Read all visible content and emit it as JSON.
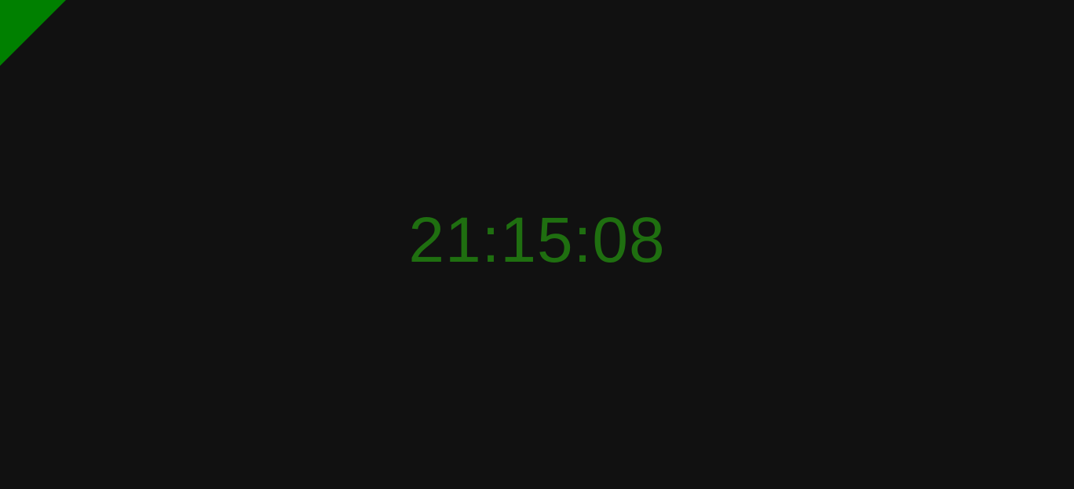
{
  "clock": {
    "time": "21:15:08",
    "color": "#1f6f10"
  },
  "corner_indicator": {
    "color": "#008000"
  },
  "background_color": "#111111"
}
